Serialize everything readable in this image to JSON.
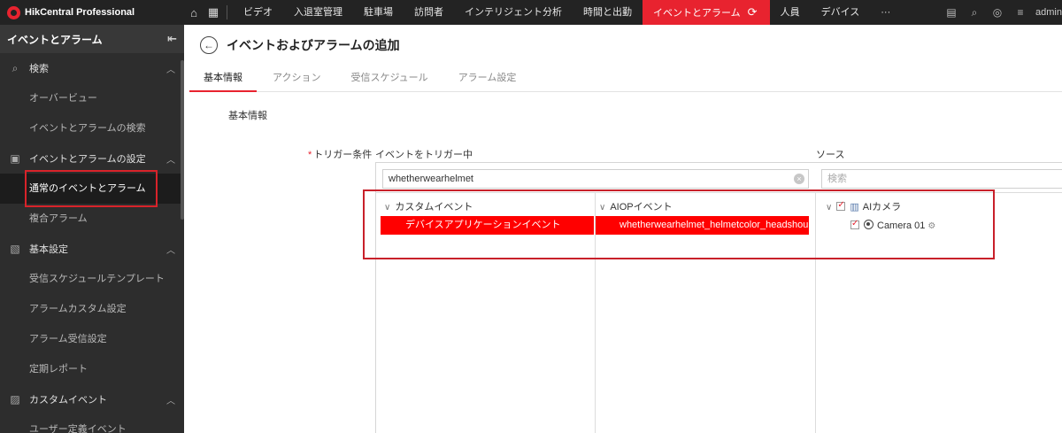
{
  "topbar": {
    "brand": "HikCentral Professional",
    "nav": [
      "ビデオ",
      "入退室管理",
      "駐車場",
      "訪問者",
      "インテリジェント分析",
      "時間と出勤",
      "イベントとアラーム",
      "人員",
      "デバイス",
      "···"
    ],
    "active_index": 6,
    "user": "admin"
  },
  "sidebar": {
    "title": "イベントとアラーム",
    "sections": {
      "search": "検索",
      "event_settings": "イベントとアラームの設定",
      "basic_settings": "基本設定",
      "custom_event": "カスタムイベント"
    },
    "items": {
      "overview": "オーバービュー",
      "event_search": "イベントとアラームの検索",
      "normal_event": "通常のイベントとアラーム",
      "composite_alarm": "複合アラーム",
      "schedule_template": "受信スケジュールテンプレート",
      "alarm_custom": "アラームカスタム設定",
      "alarm_receive": "アラーム受信設定",
      "report": "定期レポート",
      "user_defined": "ユーザー定義イベント"
    }
  },
  "main": {
    "title": "イベントおよびアラームの追加",
    "tabs": [
      "基本情報",
      "アクション",
      "受信スケジュール",
      "アラーム設定"
    ],
    "section_title": "基本情報",
    "trigger_label": "トリガー条件",
    "required_mark": "*",
    "col1_header": "イベントをトリガー中",
    "col2_header": "ソース",
    "search_value": "whetherwearhelmet",
    "source_search_placeholder": "検索",
    "custom_event_group": "カスタムイベント",
    "custom_event_selected": "デバイスアプリケーションイベント",
    "aiop_group": "AIOPイベント",
    "aiop_selected": "whetherwearhelmet_helmetcolor_headshoulder",
    "source_group": "AIカメラ",
    "camera": "Camera 01"
  },
  "colors": {
    "accent": "#e8232f",
    "highlight_row": "#ff0000",
    "annotation_box": "#c8202a"
  }
}
